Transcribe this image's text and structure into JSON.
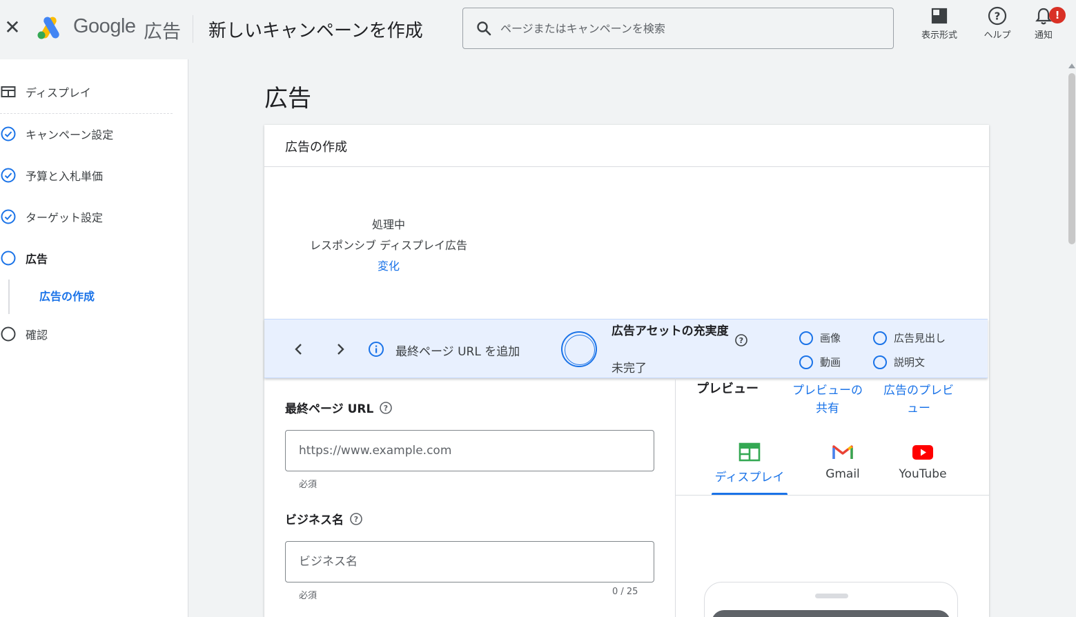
{
  "header": {
    "brand": "Google",
    "brand_sub": "広告",
    "title": "新しいキャンペーンを作成",
    "search_placeholder": "ページまたはキャンペーンを検索",
    "tools": [
      {
        "label": "表示形式",
        "icon": "appearance-icon"
      },
      {
        "label": "ヘルプ",
        "icon": "help-icon"
      },
      {
        "label": "通知",
        "icon": "bell-icon",
        "badge": "!"
      }
    ]
  },
  "sidebar": {
    "items": [
      {
        "label": "ディスプレイ",
        "icon": "display-icon"
      },
      {
        "label": "キャンペーン設定",
        "icon": "check-circle-icon"
      },
      {
        "label": "予算と入札単価",
        "icon": "check-circle-icon"
      },
      {
        "label": "ターゲット設定",
        "icon": "check-circle-icon"
      },
      {
        "label": "広告",
        "icon": "circle-active-icon"
      },
      {
        "label": "確認",
        "icon": "circle-icon"
      }
    ],
    "sub_item": "広告の作成"
  },
  "main": {
    "heading": "広告",
    "card_title": "広告の作成",
    "processing": {
      "status": "処理中",
      "ad_type": "レスポンシブ ディスプレイ広告",
      "change_link": "変化"
    },
    "stepbar": {
      "step_text": "最終ページ URL を追加",
      "strength_title": "広告アセットの充実度",
      "strength_status": "未完了",
      "checklist": [
        "画像",
        "動画",
        "広告見出し",
        "説明文"
      ]
    },
    "final_url": {
      "label": "最終ページ URL",
      "placeholder": "https://www.example.com",
      "helper": "必須"
    },
    "business_name": {
      "label": "ビジネス名",
      "placeholder": "ビジネス名",
      "helper": "必須",
      "counter": "0 / 25"
    },
    "preview": {
      "title": "プレビュー",
      "share_link": "プレビューの共有",
      "ad_preview_link": "広告のプレビュー",
      "tabs": [
        {
          "label": "ディスプレイ",
          "icon": "display-tab-icon",
          "active": true
        },
        {
          "label": "Gmail",
          "icon": "gmail-icon"
        },
        {
          "label": "YouTube",
          "icon": "youtube-icon"
        }
      ]
    }
  },
  "colors": {
    "accent": "#1a73e8",
    "stepbar_bg": "#e8f0fe",
    "badge": "#d93025"
  }
}
